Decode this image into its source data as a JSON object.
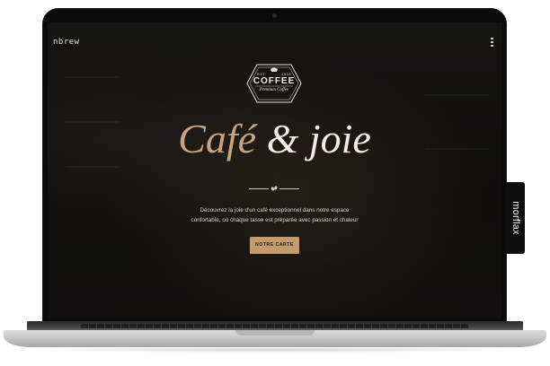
{
  "site": {
    "logo": "nbrew"
  },
  "badge": {
    "est": "EST",
    "year": "1918",
    "title": "COFFEE",
    "subtitle": "Premium Coffee"
  },
  "hero": {
    "headline_part1": "Café",
    "headline_part2": "& joie",
    "description_line1": "Découvrez la joie d'un café exceptionnel dans notre espace",
    "description_line2": "confortable, où chaque tasse est préparée avec passion et chaleur",
    "cta_label": "NOTRE CARTE"
  },
  "device": {
    "side_tag": "morflax"
  },
  "colors": {
    "accent": "#c49a6e",
    "headline_accent": "#c9a37d",
    "headline_light": "#f1ece4",
    "background": "#121110"
  }
}
